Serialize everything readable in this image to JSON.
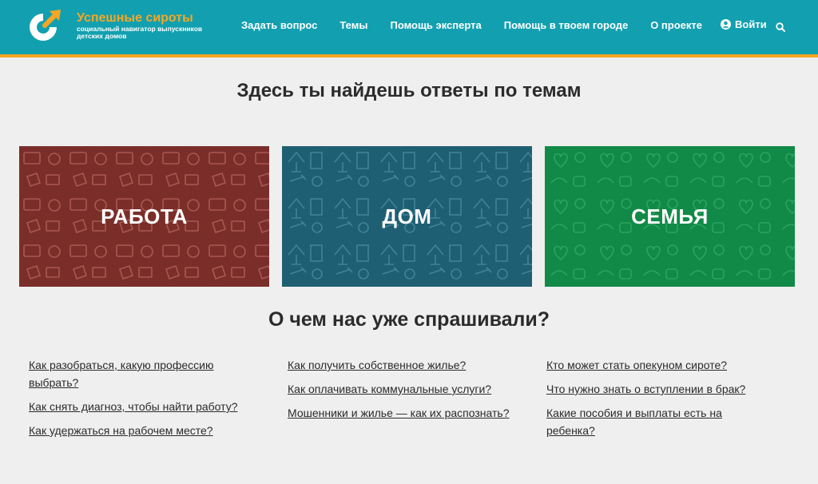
{
  "site": {
    "title": "Успешные сироты",
    "subtitle": "социальный навигатор выпускников детских домов"
  },
  "nav": {
    "items": [
      "Задать вопрос",
      "Темы",
      "Помощь эксперта",
      "Помощь в твоем городе",
      "О проекте"
    ],
    "login": "Войти"
  },
  "main": {
    "topics_heading": "Здесь ты найдешь ответы по темам",
    "topics": [
      "РАБОТА",
      "ДОМ",
      "СЕМЬЯ"
    ],
    "faq_heading": "О чем нас уже спрашивали?",
    "questions": [
      [
        "Как разобраться, какую профессию выбрать?",
        "Как снять диагноз, чтобы найти работу?",
        "Как удержаться на рабочем месте?"
      ],
      [
        "Как получить собственное жилье?",
        "Как оплачивать коммунальные услуги?",
        "Мошенники и жилье — как их распознать?"
      ],
      [
        "Кто может стать опекуном сироте?",
        "Что нужно знать о вступлении в брак?",
        "Какие пособия и выплаты есть на ребенка?"
      ]
    ]
  },
  "colors": {
    "header": "#12a0b0",
    "accent": "#f4a620",
    "work": "#7a2e2a",
    "home": "#1f5f73",
    "family": "#118a47"
  },
  "icons": [
    "logo-icon",
    "user-icon",
    "search-icon"
  ]
}
